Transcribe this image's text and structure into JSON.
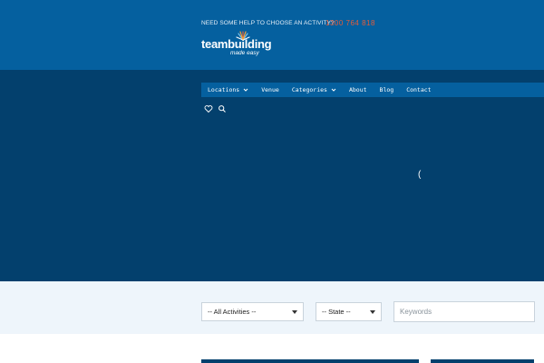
{
  "header": {
    "help_text": "NEED SOME HELP TO CHOOSE AN ACTIVITY?",
    "phone": "1300 764 818",
    "logo_wordmark": "teambuilding",
    "logo_tagline": "made easy"
  },
  "nav": {
    "items": [
      {
        "label": "Locations",
        "has_dropdown": true
      },
      {
        "label": "Venue",
        "has_dropdown": false
      },
      {
        "label": "Categories",
        "has_dropdown": true
      },
      {
        "label": "About",
        "has_dropdown": false
      },
      {
        "label": "Blog",
        "has_dropdown": false
      },
      {
        "label": "Contact",
        "has_dropdown": false
      }
    ],
    "icons": [
      "heart-icon",
      "search-icon"
    ]
  },
  "hero": {
    "loader_glyph": "("
  },
  "filters": {
    "activities_selected": "-- All Activities --",
    "state_selected": "-- State --",
    "keywords_placeholder": "Keywords"
  },
  "colors": {
    "header_bg": "#05609f",
    "hero_bg": "#03406d",
    "phone": "#e45c3a",
    "filter_band_bg": "#eef5fb"
  }
}
